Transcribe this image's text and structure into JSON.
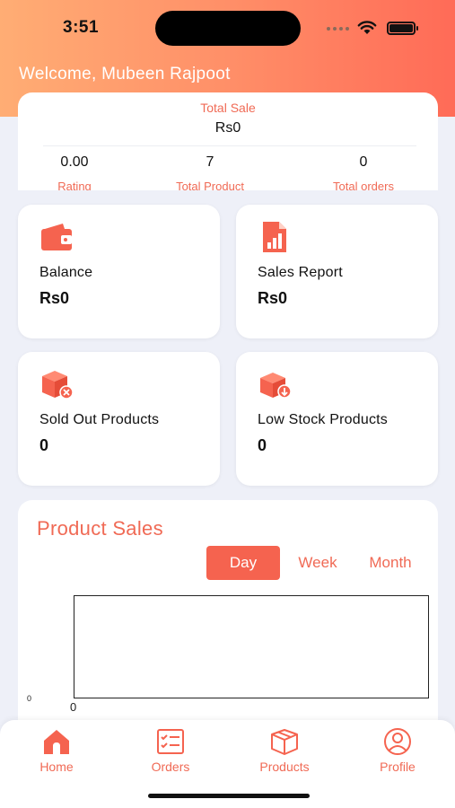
{
  "status_bar": {
    "time": "3:51"
  },
  "welcome": "Welcome, Mubeen Rajpoot",
  "summary": {
    "title": "Total Sale",
    "value": "Rs0",
    "stats": [
      {
        "value": "0.00",
        "label": "Rating"
      },
      {
        "value": "7",
        "label": "Total Product"
      },
      {
        "value": "0",
        "label": "Total orders"
      }
    ]
  },
  "cards": [
    {
      "icon": "wallet-icon",
      "label": "Balance",
      "value": "Rs0"
    },
    {
      "icon": "sales-report-icon",
      "label": "Sales Report",
      "value": "Rs0"
    },
    {
      "icon": "sold-out-box-icon",
      "label": "Sold Out Products",
      "value": "0"
    },
    {
      "icon": "low-stock-box-icon",
      "label": "Low Stock Products",
      "value": "0"
    }
  ],
  "product_sales": {
    "title": "Product Sales",
    "periods": [
      "Day",
      "Week",
      "Month"
    ],
    "selected_period": "Day"
  },
  "chart_data": {
    "type": "line",
    "title": "Product Sales",
    "x": [
      0
    ],
    "series": [
      {
        "values": [
          0
        ]
      }
    ],
    "x_tick_labels": [
      "0"
    ],
    "y_tick_labels": [
      "0"
    ]
  },
  "tabs": [
    {
      "label": "Home",
      "icon": "home-icon"
    },
    {
      "label": "Orders",
      "icon": "orders-icon"
    },
    {
      "label": "Products",
      "icon": "products-icon"
    },
    {
      "label": "Profile",
      "icon": "profile-icon"
    }
  ],
  "colors": {
    "accent": "#f5634f",
    "header_start": "#ffad74",
    "header_end": "#ff6b57",
    "background": "#eef0f8"
  }
}
